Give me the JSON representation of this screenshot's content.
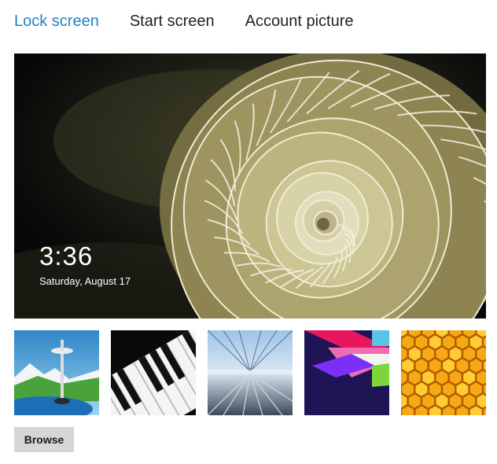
{
  "tabs": [
    {
      "label": "Lock screen",
      "active": true
    },
    {
      "label": "Start screen",
      "active": false
    },
    {
      "label": "Account picture",
      "active": false
    }
  ],
  "lock_preview": {
    "time": "3:36",
    "date": "Saturday, August 17"
  },
  "thumbnails": [
    {
      "subject": "space-needle"
    },
    {
      "subject": "piano-keys"
    },
    {
      "subject": "rail-tracks"
    },
    {
      "subject": "color-shapes"
    },
    {
      "subject": "honeycomb"
    }
  ],
  "browse_label": "Browse",
  "colors": {
    "accent": "#1a86c4",
    "tab_text": "#222222",
    "button_bg": "#d6d6d6"
  }
}
